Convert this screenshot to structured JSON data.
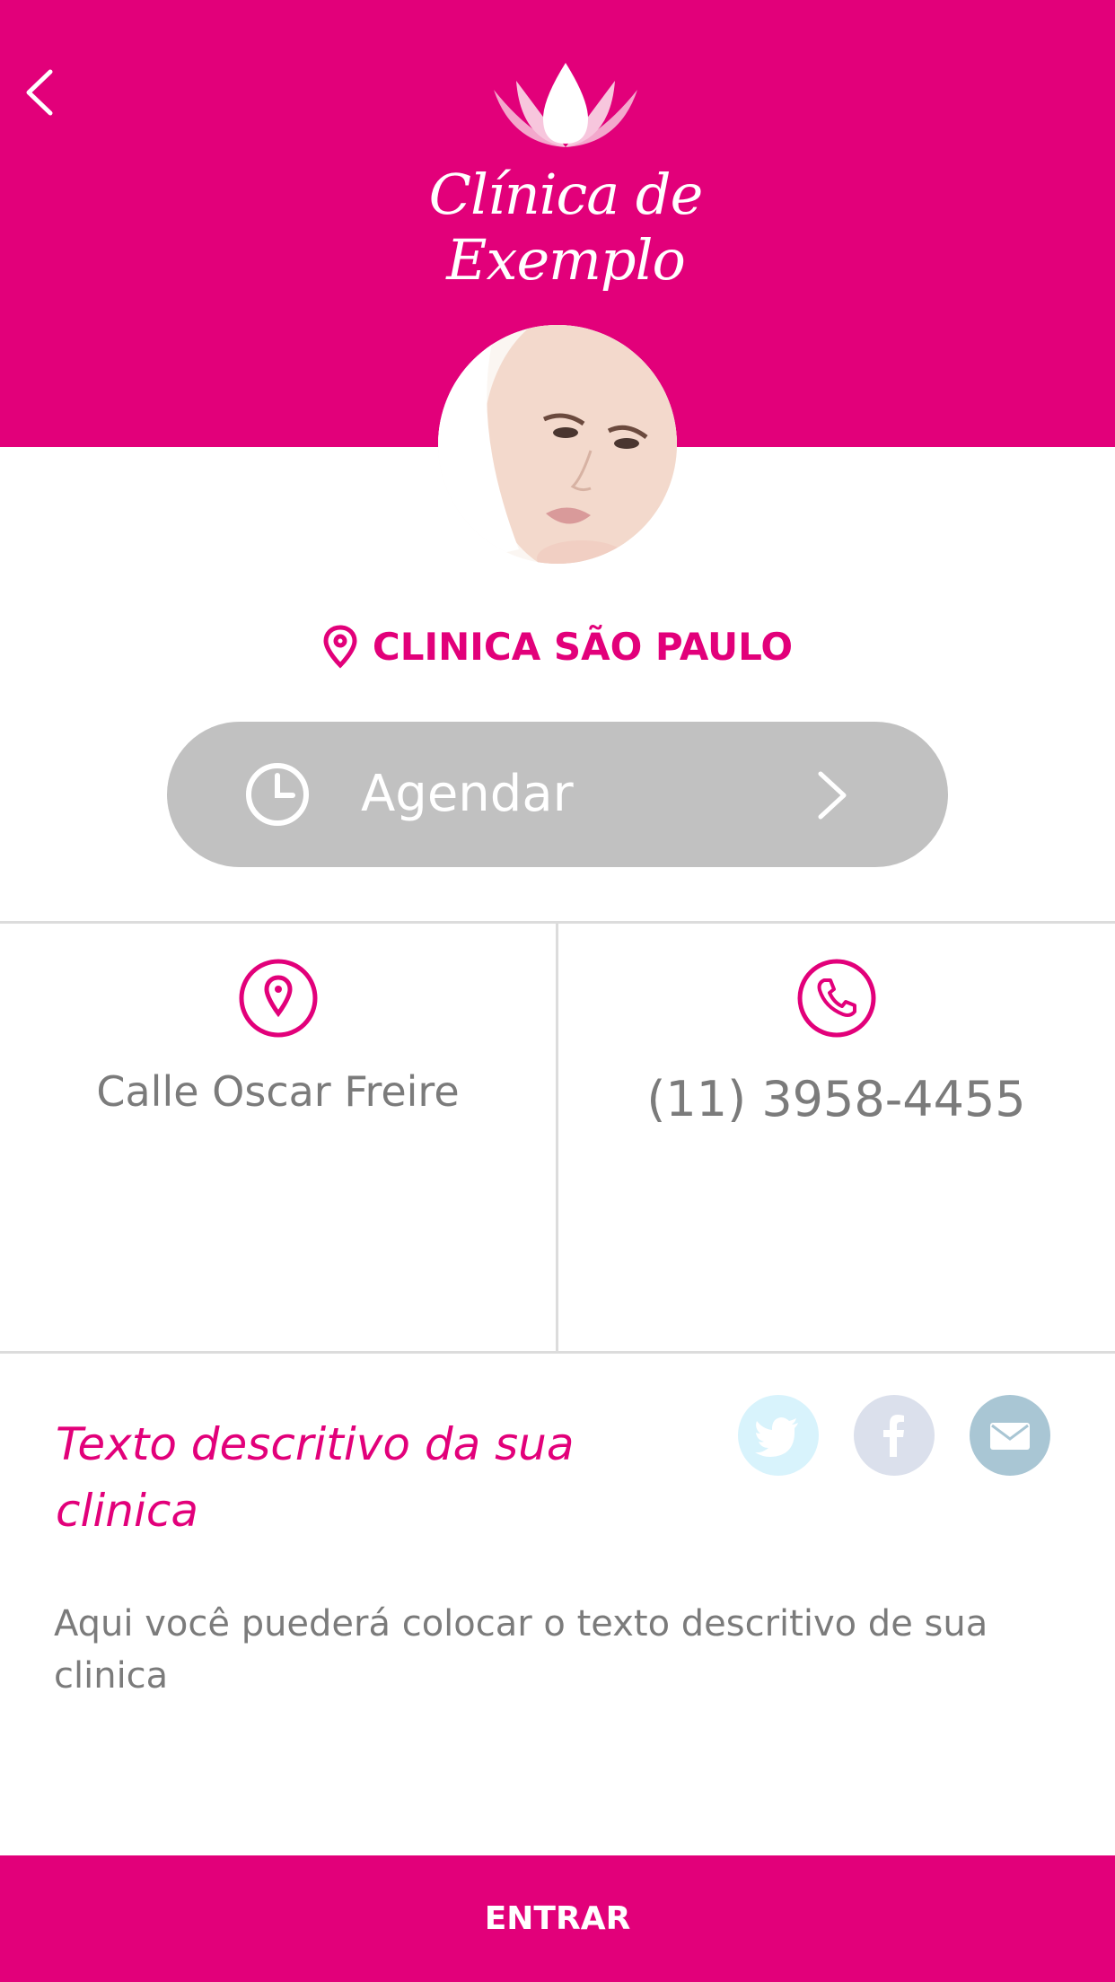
{
  "header": {
    "logo_text": "Clínica de Exemplo",
    "back_icon": "chevron-left-icon",
    "logo_icon": "lotus-drop-icon",
    "background_color": "#e2007a"
  },
  "clinic": {
    "name": "CLINICA SÃO PAULO",
    "name_icon": "location-pin-icon"
  },
  "schedule_button": {
    "label": "Agendar",
    "left_icon": "clock-icon",
    "right_icon": "chevron-right-icon"
  },
  "info": {
    "address": {
      "icon": "location-pin-icon",
      "value": "Calle Oscar Freire"
    },
    "phone": {
      "icon": "phone-icon",
      "value": "(11) 3958-4455"
    }
  },
  "description": {
    "title": "Texto descritivo da sua clinica",
    "body": "Aqui você puederá colocar o texto descritivo de sua clinica"
  },
  "social": [
    {
      "name": "twitter",
      "icon": "twitter-icon",
      "color": "#d8f3fc"
    },
    {
      "name": "facebook",
      "icon": "facebook-icon",
      "color": "#dbe0ec"
    },
    {
      "name": "email",
      "icon": "mail-icon",
      "color": "#a9c6d4"
    }
  ],
  "footer": {
    "button_label": "ENTRAR"
  },
  "colors": {
    "accent": "#e2007a",
    "button_gray": "#c1c1c1",
    "text_gray": "#7b7b7b"
  }
}
